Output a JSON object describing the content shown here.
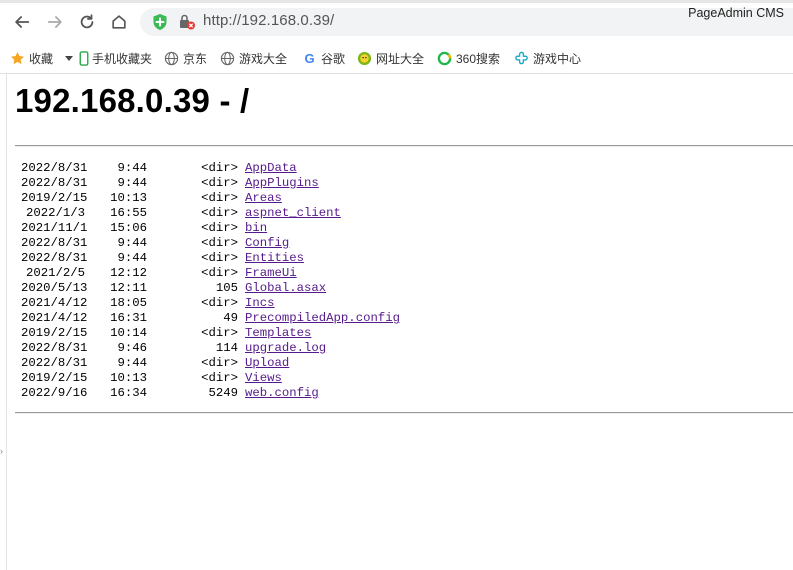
{
  "browser": {
    "url": "http://192.168.0.39/",
    "app_title": "PageAdmin CMS"
  },
  "bookmarks": [
    {
      "label": "收藏",
      "icon": "star-icon"
    },
    {
      "label": "手机收藏夹",
      "icon": "phone-icon"
    },
    {
      "label": "京东",
      "icon": "globe-icon"
    },
    {
      "label": "游戏大全",
      "icon": "globe-icon"
    },
    {
      "label": "谷歌",
      "icon": "google-icon"
    },
    {
      "label": "网址大全",
      "icon": "smile-icon"
    },
    {
      "label": "360搜索",
      "icon": "360-icon"
    },
    {
      "label": "游戏中心",
      "icon": "gamepad-icon"
    }
  ],
  "page": {
    "title": "192.168.0.39 - /",
    "entries": [
      {
        "date": "2022/8/31",
        "time": "9:44",
        "size": "<dir>",
        "name": "AppData"
      },
      {
        "date": "2022/8/31",
        "time": "9:44",
        "size": "<dir>",
        "name": "AppPlugins"
      },
      {
        "date": "2019/2/15",
        "time": "10:13",
        "size": "<dir>",
        "name": "Areas"
      },
      {
        "date": "2022/1/3",
        "time": "16:55",
        "size": "<dir>",
        "name": "aspnet_client"
      },
      {
        "date": "2021/11/1",
        "time": "15:06",
        "size": "<dir>",
        "name": "bin"
      },
      {
        "date": "2022/8/31",
        "time": "9:44",
        "size": "<dir>",
        "name": "Config"
      },
      {
        "date": "2022/8/31",
        "time": "9:44",
        "size": "<dir>",
        "name": "Entities"
      },
      {
        "date": "2021/2/5",
        "time": "12:12",
        "size": "<dir>",
        "name": "FrameUi"
      },
      {
        "date": "2020/5/13",
        "time": "12:11",
        "size": "105",
        "name": "Global.asax"
      },
      {
        "date": "2021/4/12",
        "time": "18:05",
        "size": "<dir>",
        "name": "Incs"
      },
      {
        "date": "2021/4/12",
        "time": "16:31",
        "size": "49",
        "name": "PrecompiledApp.config"
      },
      {
        "date": "2019/2/15",
        "time": "10:14",
        "size": "<dir>",
        "name": "Templates"
      },
      {
        "date": "2022/8/31",
        "time": "9:46",
        "size": "114",
        "name": "upgrade.log"
      },
      {
        "date": "2022/8/31",
        "time": "9:44",
        "size": "<dir>",
        "name": "Upload"
      },
      {
        "date": "2019/2/15",
        "time": "10:13",
        "size": "<dir>",
        "name": "Views"
      },
      {
        "date": "2022/9/16",
        "time": "16:34",
        "size": "5249",
        "name": "web.config"
      }
    ]
  }
}
